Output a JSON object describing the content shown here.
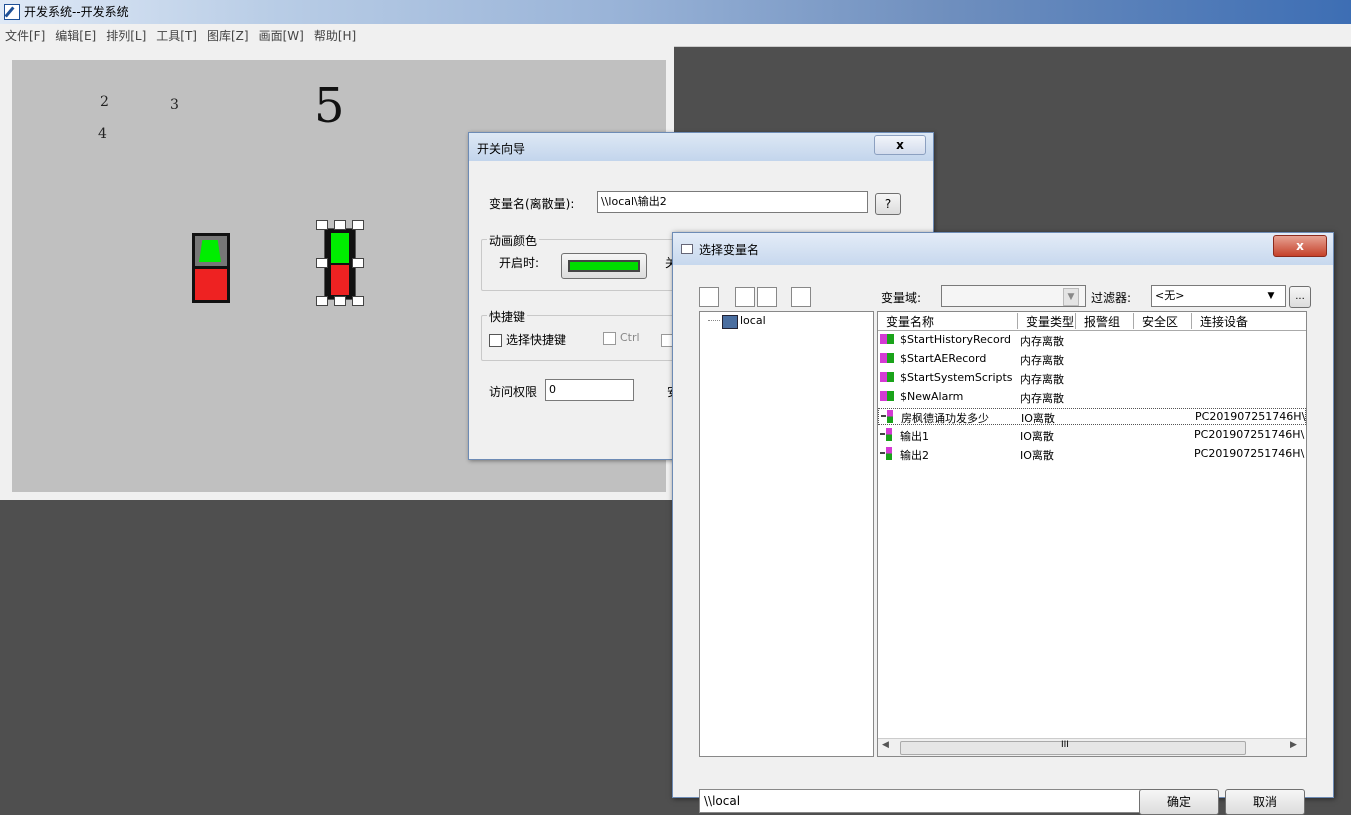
{
  "window": {
    "title": "开发系统--开发系统"
  },
  "menu": [
    "文件[F]",
    "编辑[E]",
    "排列[L]",
    "工具[T]",
    "图库[Z]",
    "画面[W]",
    "帮助[H]"
  ],
  "canvas": {
    "labels": [
      "2",
      "3",
      "4",
      "5"
    ]
  },
  "wizard": {
    "title": "开关向导",
    "var_label": "变量名(离散量):",
    "var_value": "\\\\local\\输出2",
    "help_button": "?",
    "anim_group": "动画颜色",
    "on_label": "开启时:",
    "on_color": "#00dd00",
    "off_label_partial": "关",
    "hotkey_group": "快捷键",
    "hotkey_checkbox": "选择快捷键",
    "ctrl_checkbox": "Ctrl",
    "access_label": "访问权限",
    "access_value": "0",
    "security_partial": "安",
    "close_symbol": "x"
  },
  "select_dialog": {
    "title": "选择变量名",
    "close_symbol": "x",
    "domain_label": "变量域:",
    "filter_label": "过滤器:",
    "filter_value": "<无>",
    "browse_button": "...",
    "tree_root": "local",
    "columns": [
      "变量名称",
      "变量类型",
      "报警组",
      "安全区",
      "连接设备"
    ],
    "rows": [
      {
        "name": "$StartHistoryRecord",
        "type": "内存离散",
        "alarm": "",
        "zone": "",
        "device": "",
        "icon": "mem"
      },
      {
        "name": "$StartAERecord",
        "type": "内存离散",
        "alarm": "",
        "zone": "",
        "device": "",
        "icon": "mem"
      },
      {
        "name": "$StartSystemScripts",
        "type": "内存离散",
        "alarm": "",
        "zone": "",
        "device": "",
        "icon": "mem"
      },
      {
        "name": "$NewAlarm",
        "type": "内存离散",
        "alarm": "",
        "zone": "",
        "device": "",
        "icon": "mem"
      },
      {
        "name": "房枫德诵功发多少",
        "type": "IO离散",
        "alarm": "",
        "zone": "",
        "device": "PC201907251746H\\",
        "icon": "io"
      },
      {
        "name": "输出1",
        "type": "IO离散",
        "alarm": "",
        "zone": "",
        "device": "PC201907251746H\\",
        "icon": "io"
      },
      {
        "name": "输出2",
        "type": "IO离散",
        "alarm": "",
        "zone": "",
        "device": "PC201907251746H\\",
        "icon": "io"
      }
    ],
    "scroll_mid": "III",
    "status_path": "\\\\local",
    "ok_button": "确定",
    "cancel_button": "取消"
  }
}
